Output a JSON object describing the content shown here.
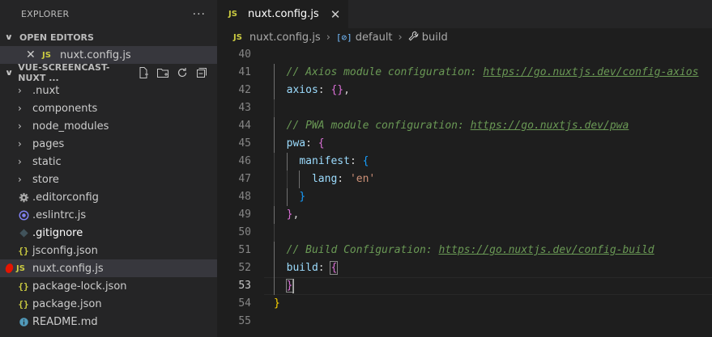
{
  "sidebar": {
    "title": "EXPLORER",
    "more": "···",
    "open_editors": {
      "header": "OPEN EDITORS",
      "items": [
        {
          "close": "✕",
          "icon": "JS",
          "label": "nuxt.config.js"
        }
      ]
    },
    "project": {
      "header": "VUE-SCREENCAST-NUXT ...",
      "folders": [
        ".nuxt",
        "components",
        "node_modules",
        "pages",
        "static",
        "store"
      ],
      "files": [
        {
          "name": ".editorconfig",
          "icon": "gear-icon"
        },
        {
          "name": ".eslintrc.js",
          "icon": "eslint-icon"
        },
        {
          "name": ".gitignore",
          "icon": "git-diamond-icon"
        },
        {
          "name": "jsconfig.json",
          "icon": "{}"
        },
        {
          "name": "nuxt.config.js",
          "icon": "JS"
        },
        {
          "name": "package-lock.json",
          "icon": "{}"
        },
        {
          "name": "package.json",
          "icon": "{}"
        },
        {
          "name": "README.md",
          "icon": "info-icon"
        }
      ]
    }
  },
  "tab": {
    "icon": "JS",
    "label": "nuxt.config.js",
    "close": "✕"
  },
  "breadcrumb": {
    "file_icon": "JS",
    "file": "nuxt.config.js",
    "symbol1": "default",
    "symbol2": "build"
  },
  "code": {
    "lines": [
      {
        "n": "40"
      },
      {
        "n": "41",
        "comment": "// Axios module configuration: ",
        "link": "https://go.nuxtjs.dev/config-axios"
      },
      {
        "n": "42",
        "prop": "axios",
        "rest": ": ",
        "open": "{",
        "close": "}",
        "tail": ","
      },
      {
        "n": "43"
      },
      {
        "n": "44",
        "comment": "// PWA module configuration: ",
        "link": "https://go.nuxtjs.dev/pwa"
      },
      {
        "n": "45",
        "prop": "pwa",
        "rest": ": ",
        "open": "{"
      },
      {
        "n": "46",
        "prop": "manifest",
        "rest": ": ",
        "open": "{"
      },
      {
        "n": "47",
        "prop": "lang",
        "rest": ": ",
        "string": "'en'"
      },
      {
        "n": "48",
        "close": "}"
      },
      {
        "n": "49",
        "close": "}",
        "tail": ","
      },
      {
        "n": "50"
      },
      {
        "n": "51",
        "comment": "// Build Configuration: ",
        "link": "https://go.nuxtjs.dev/config-build"
      },
      {
        "n": "52",
        "prop": "build",
        "rest": ": ",
        "open": "{"
      },
      {
        "n": "53",
        "close": "}"
      },
      {
        "n": "54",
        "close": "}"
      },
      {
        "n": "55"
      }
    ]
  }
}
